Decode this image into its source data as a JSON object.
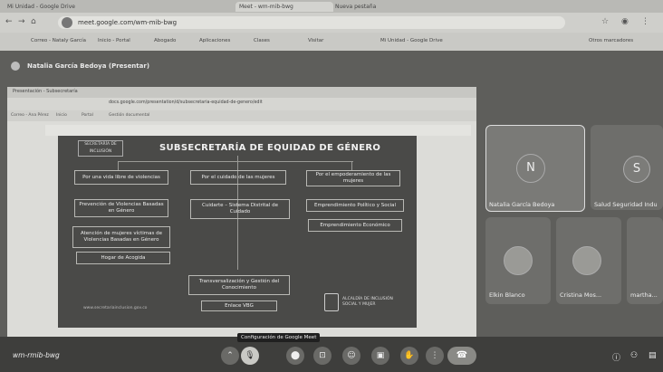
{
  "browser": {
    "tabs": [
      "Mi Unidad - Google Drive",
      "Meet - wm-mib-bwg",
      "Nueva pestaña"
    ],
    "url": "meet.google.com/wm-mib-bwg",
    "bookmarks": [
      "Correo - Nataly García",
      "Inicio - Portal",
      "Abogado",
      "Aplicaciones",
      "Clases",
      "Visitar",
      "Mi Unidad - Google Drive",
      "Otros marcadores"
    ]
  },
  "meet": {
    "presenter": "Natalia García Bedoya (Presentar)",
    "meeting_code": "wm-rmib-bwg",
    "tooltip": "Configuración de Google Meet"
  },
  "shared_screen": {
    "inner_tab": "Presentación - Subsecretaría",
    "inner_url": "docs.google.com/presentation/d/subsecretaria-equidad-de-genero/edit",
    "inner_bookmarks": [
      "Correo - Ana Pérez",
      "Inicio",
      "Portal",
      "Gestión documental"
    ],
    "slide": {
      "title": "SUBSECRETARÍA DE EQUIDAD DE GÉNERO",
      "logo_text": "SECRETARÍA DE INCLUSIÓN",
      "boxes": {
        "b1": "Por una vida libre de violencias",
        "b2": "Por el cuidado de las mujeres",
        "b3": "Por el empoderamiento de las mujeres",
        "b4": "Prevención de Violencias Basadas en Género",
        "b5": "Cuidarte – Sistema Distrital de Cuidado",
        "b6": "Emprendimiento Político y Social",
        "b7": "Atención de mujeres víctimas de Violencias Basadas en Género",
        "b8": "Emprendimiento Económico",
        "b9": "Hogar de Acogida",
        "b10": "Transversalización y Gestión del Conocimiento",
        "b11": "Enlace VBG"
      },
      "footer_url": "www.secretariainclusion.gov.co",
      "ministry_text": "ALCALDÍA DE INCLUSIÓN SOCIAL Y MUJER"
    }
  },
  "participants": [
    {
      "name": "Natalia García Bedoya",
      "initial": "N"
    },
    {
      "name": "Salud Seguridad Indu",
      "initial": "S"
    },
    {
      "name": "Elkin Blanco",
      "initial": ""
    },
    {
      "name": "Cristina Mos...",
      "initial": ""
    },
    {
      "name": "martha...",
      "initial": ""
    }
  ],
  "controls": {
    "mic": "🎙",
    "camera": "⬤",
    "captions": "⊡",
    "emoji": "☺",
    "present": "▣",
    "hand": "✋",
    "more": "⋮",
    "end": "☎"
  }
}
